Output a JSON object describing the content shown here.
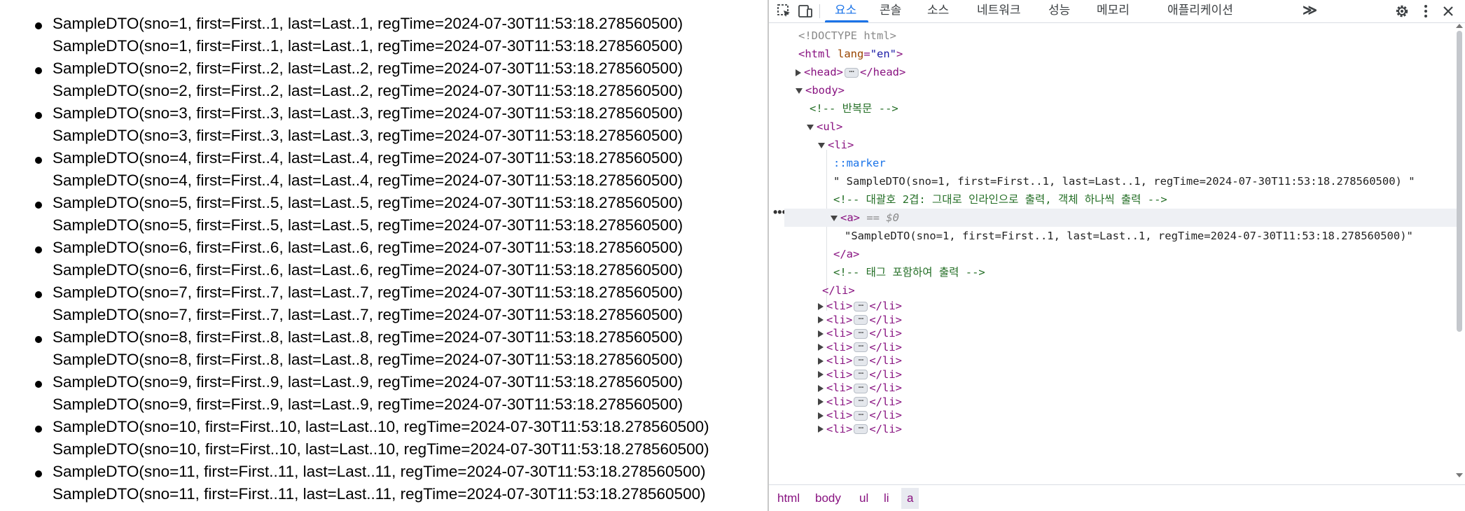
{
  "page": {
    "items": [
      "SampleDTO(sno=1, first=First..1, last=Last..1, regTime=2024-07-30T11:53:18.278560500)",
      "SampleDTO(sno=2, first=First..2, last=Last..2, regTime=2024-07-30T11:53:18.278560500)",
      "SampleDTO(sno=3, first=First..3, last=Last..3, regTime=2024-07-30T11:53:18.278560500)",
      "SampleDTO(sno=4, first=First..4, last=Last..4, regTime=2024-07-30T11:53:18.278560500)",
      "SampleDTO(sno=5, first=First..5, last=Last..5, regTime=2024-07-30T11:53:18.278560500)",
      "SampleDTO(sno=6, first=First..6, last=Last..6, regTime=2024-07-30T11:53:18.278560500)",
      "SampleDTO(sno=7, first=First..7, last=Last..7, regTime=2024-07-30T11:53:18.278560500)",
      "SampleDTO(sno=8, first=First..8, last=Last..8, regTime=2024-07-30T11:53:18.278560500)",
      "SampleDTO(sno=9, first=First..9, last=Last..9, regTime=2024-07-30T11:53:18.278560500)",
      "SampleDTO(sno=10, first=First..10, last=Last..10, regTime=2024-07-30T11:53:18.278560500)",
      "SampleDTO(sno=11, first=First..11, last=Last..11, regTime=2024-07-30T11:53:18.278560500)"
    ]
  },
  "devtools": {
    "toolbar_icons": [
      "inspect-element-icon",
      "device-toolbar-icon"
    ],
    "tabs": [
      {
        "label": "요소",
        "active": true
      },
      {
        "label": "콘솔",
        "active": false
      },
      {
        "label": "소스",
        "active": false
      },
      {
        "label": "네트워크",
        "active": false
      },
      {
        "label": "성능",
        "active": false
      },
      {
        "label": "메모리",
        "active": false
      },
      {
        "label": "애플리케이션",
        "active": false
      }
    ],
    "more_tabs": "≫",
    "right_icons": [
      "settings-icon",
      "more-vert-icon",
      "close-icon"
    ],
    "tree": {
      "doctype": "<!DOCTYPE html>",
      "html_open_tag": "<html",
      "html_attr_name": "lang",
      "html_attr_value": "\"en\"",
      "html_close_bracket": ">",
      "head_open": "<head>",
      "head_close": "</head>",
      "body_open": "<body>",
      "comment_loop": "<!-- 반복문 -->",
      "ul_open": "<ul>",
      "li_open": "<li>",
      "marker": "::marker",
      "text_node": "\" SampleDTO(sno=1, first=First..1, last=Last..1, regTime=2024-07-30T11:53:18.278560500) \"",
      "comment_inline": "<!--   대괄호 2겹: 그대로 인라인으로 출력, 객체 하나씩 출력        -->",
      "a_open": "<a>",
      "a_selected_marker": "== $0",
      "a_text": "\"SampleDTO(sno=1, first=First..1, last=Last..1, regTime=2024-07-30T11:53:18.278560500)\"",
      "a_close": "</a>",
      "comment_tag": "<!--   태그 포함하여 출력       -->",
      "li_close": "</li>",
      "collapsed_li_open": "<li>",
      "collapsed_li_close": "</li>",
      "collapsed_li_count": 10,
      "ellipsis": "⋯"
    },
    "gutter_dots": "•••",
    "breadcrumbs": [
      {
        "label": "html",
        "active": false
      },
      {
        "label": "body",
        "active": false
      },
      {
        "label": "ul",
        "active": false
      },
      {
        "label": "li",
        "active": false
      },
      {
        "label": "a",
        "active": true
      }
    ]
  }
}
